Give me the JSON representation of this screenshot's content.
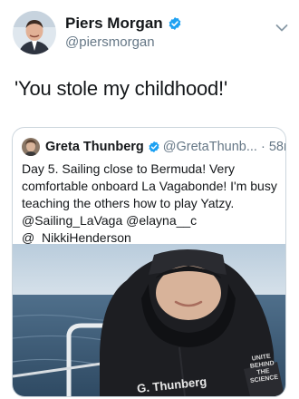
{
  "author": {
    "name": "Piers Morgan",
    "handle": "@piersmorgan"
  },
  "tweet_text": "'You stole my childhood!'",
  "quoted": {
    "name": "Greta Thunberg",
    "handle": "@GretaThunb...",
    "time": "58m",
    "lines": [
      "Day 5. Sailing close to Bermuda! Very",
      "comfortable onboard La Vagabonde! I'm busy",
      "teaching the others how to play Yatzy.",
      "@Sailing_LaVaga @elayna__c",
      "@_NikkiHenderson"
    ],
    "jacket_name": "G. Thunberg",
    "jacket_patch": "UNITE BEHIND THE SCIENCE"
  },
  "icons": {
    "verified": "verified-badge-icon",
    "caret": "chevron-down-icon"
  },
  "colors": {
    "verified_blue": "#1da1f2",
    "secondary_text": "#657786",
    "border": "#ccd6dd"
  }
}
